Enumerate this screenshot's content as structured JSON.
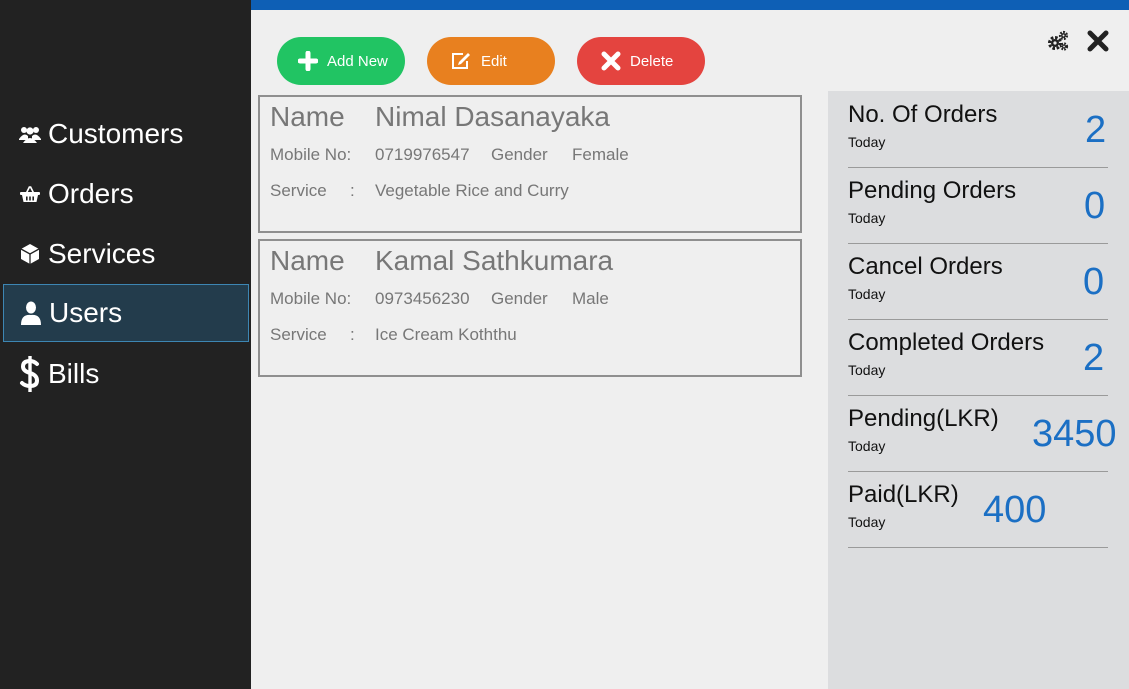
{
  "colors": {
    "accent": "#1b6fc4",
    "add": "#21c463",
    "edit": "#e8801f",
    "delete": "#e4443f",
    "sidebar_active": "#233c4c"
  },
  "sidebar": {
    "items": [
      {
        "label": "Customers",
        "icon": "users-icon"
      },
      {
        "label": "Orders",
        "icon": "basket-icon"
      },
      {
        "label": "Services",
        "icon": "cube-icon"
      },
      {
        "label": "Users",
        "icon": "user-icon",
        "active": true
      },
      {
        "label": "Bills",
        "icon": "dollar-icon"
      }
    ]
  },
  "toolbar": {
    "add_label": "Add New",
    "edit_label": "Edit",
    "delete_label": "Delete"
  },
  "window": {
    "settings_icon": "gears-icon",
    "close_icon": "close-icon"
  },
  "labels": {
    "name": "Name",
    "mobile": "Mobile No:",
    "gender": "Gender",
    "service": "Service",
    "colon": ":"
  },
  "records": [
    {
      "name": "Nimal Dasanayaka",
      "mobile": "0719976547",
      "gender": "Female",
      "service": "Vegetable Rice and Curry"
    },
    {
      "name": "Kamal Sathkumara",
      "mobile": "0973456230",
      "gender": "Male",
      "service": "Ice Cream Koththu"
    }
  ],
  "stats": [
    {
      "title": "No. Of Orders",
      "sub": "Today",
      "value": "2"
    },
    {
      "title": "Pending Orders",
      "sub": "Today",
      "value": "0"
    },
    {
      "title": "Cancel Orders",
      "sub": "Today",
      "value": "0"
    },
    {
      "title": "Completed Orders",
      "sub": "Today",
      "value": "2"
    },
    {
      "title": "Pending(LKR)",
      "sub": "Today",
      "value": "3450"
    },
    {
      "title": "Paid(LKR)",
      "sub": "Today",
      "value": "400"
    }
  ]
}
